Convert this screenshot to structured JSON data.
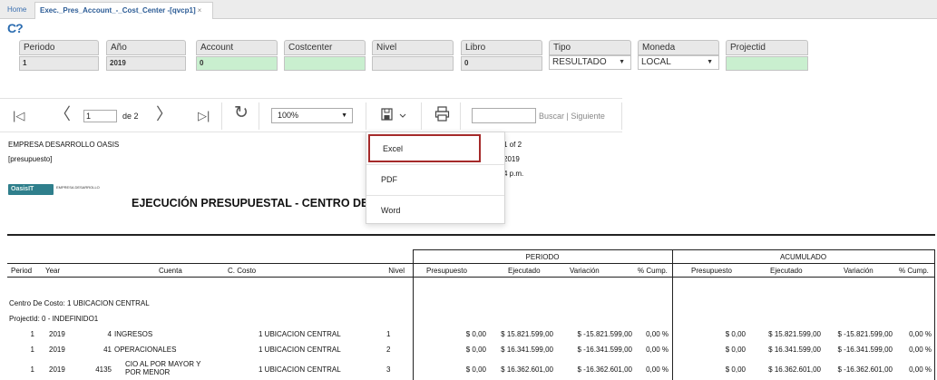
{
  "tabs": {
    "home": "Home",
    "active": "Exec._Pres_Account_-_Cost_Center -[qvcp1]",
    "close": "×"
  },
  "brand": "C?",
  "params": {
    "periodo": {
      "label": "Periodo",
      "value": "1"
    },
    "anio": {
      "label": "Año",
      "value": "2019"
    },
    "account": {
      "label": "Account",
      "value": "0"
    },
    "costcenter": {
      "label": "Costcenter",
      "value": ""
    },
    "nivel": {
      "label": "Nivel",
      "value": ""
    },
    "libro": {
      "label": "Libro",
      "value": "0"
    },
    "tipo": {
      "label": "Tipo",
      "value": "RESULTADO"
    },
    "moneda": {
      "label": "Moneda",
      "value": "LOCAL"
    },
    "projectid": {
      "label": "Projectid",
      "value": ""
    }
  },
  "toolbar": {
    "page": "1",
    "of_pages": "de 2",
    "zoom": "100%",
    "search_placeholder": "",
    "search_label": "Buscar",
    "separator": "|",
    "next_label": "Siguiente"
  },
  "export_menu": {
    "excel": "Excel",
    "pdf": "PDF",
    "word": "Word"
  },
  "report": {
    "company": "EMPRESA DESARROLLO OASIS",
    "subtitle": "[presupuesto]",
    "page_info": "1 of 2",
    "date_info": "2019",
    "time_info": "4 p.m.",
    "logo_text": "OasisIT",
    "logo_sub": "EMPRESA DESARROLLO",
    "title": "EJECUCIÓN PRESUPUESTAL - CENTRO DE C"
  },
  "table": {
    "group_periodo": "PERIODO",
    "group_acumulado": "ACUMULADO",
    "headers": {
      "period": "Period",
      "year": "Year",
      "cuenta": "Cuenta",
      "ccosto": "C. Costo",
      "nivel": "Nivel",
      "presupuesto": "Presupuesto",
      "ejecutado": "Ejecutado",
      "variacion": "Variación",
      "cump": "% Cump.",
      "presupuesto2": "Presupuesto",
      "ejecutado2": "Ejecutado",
      "variacion2": "Variación",
      "cump2": "% Cump."
    },
    "group_cc": "Centro De Costo: 1 UBICACION CENTRAL",
    "group_proj": "ProjectId: 0 - INDEFINIDO1",
    "rows": [
      {
        "period": "1",
        "year": "2019",
        "code": "4",
        "name": "INGRESOS",
        "ccosto": "1 UBICACION CENTRAL",
        "nivel": "1",
        "pres": "$ 0,00",
        "ejec": "$ 15.821.599,00",
        "var": "$ -15.821.599,00",
        "cump": "0,00 %",
        "pres2": "$ 0,00",
        "ejec2": "$ 15.821.599,00",
        "var2": "$ -15.821.599,00",
        "cump2": "0,00 %"
      },
      {
        "period": "1",
        "year": "2019",
        "code": "41",
        "name": "OPERACIONALES",
        "ccosto": "1 UBICACION CENTRAL",
        "nivel": "2",
        "pres": "$ 0,00",
        "ejec": "$ 16.341.599,00",
        "var": "$ -16.341.599,00",
        "cump": "0,00 %",
        "pres2": "$ 0,00",
        "ejec2": "$ 16.341.599,00",
        "var2": "$ -16.341.599,00",
        "cump2": "0,00 %"
      },
      {
        "period": "1",
        "year": "2019",
        "code": "4135",
        "name": "CIO AL POR MAYOR Y",
        "name2": "POR MENOR",
        "ccosto": "1 UBICACION CENTRAL",
        "nivel": "3",
        "pres": "$ 0,00",
        "ejec": "$ 16.362.601,00",
        "var": "$ -16.362.601,00",
        "cump": "0,00 %",
        "pres2": "$ 0,00",
        "ejec2": "$ 16.362.601,00",
        "var2": "$ -16.362.601,00",
        "cump2": "0,00 %"
      }
    ]
  }
}
